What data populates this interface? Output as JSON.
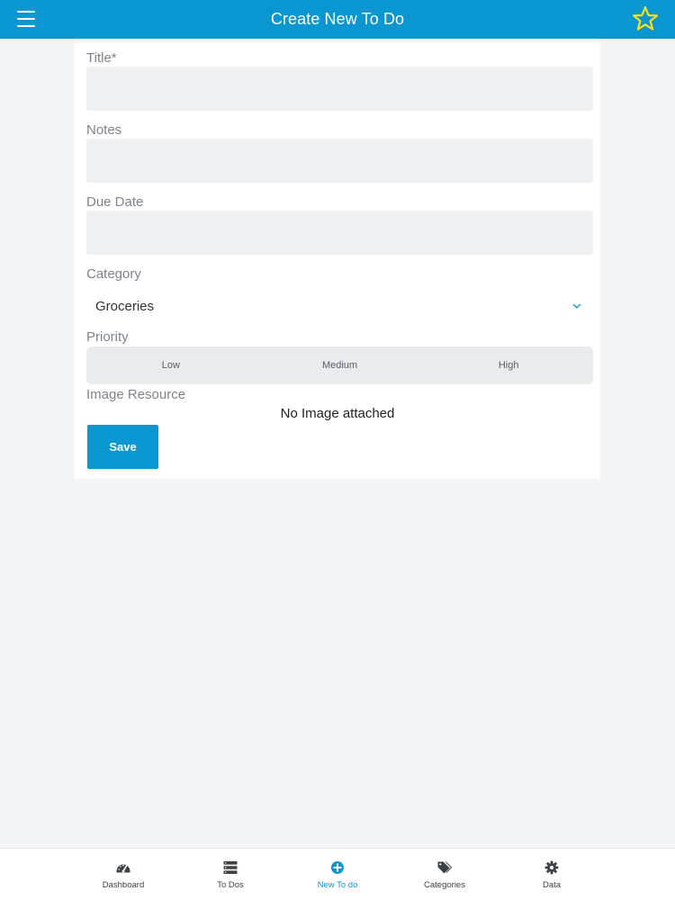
{
  "header": {
    "title": "Create New To Do",
    "menu_icon": "hamburger-menu-icon",
    "star_icon": "star-icon",
    "accent_color": "#0a96d1",
    "star_color": "#f4e21a"
  },
  "form": {
    "title_label": "Title*",
    "title_value": "",
    "notes_label": "Notes",
    "notes_value": "",
    "due_date_label": "Due Date",
    "due_date_value": "",
    "category_label": "Category",
    "category_value": "Groceries",
    "priority_label": "Priority",
    "priority_options": [
      "Low",
      "Medium",
      "High"
    ],
    "image_label": "Image Resource",
    "image_status": "No Image attached",
    "save_label": "Save"
  },
  "tabbar": {
    "items": [
      {
        "label": "Dashboard",
        "icon": "dashboard-gauge-icon",
        "active": false
      },
      {
        "label": "To Dos",
        "icon": "list-icon",
        "active": false
      },
      {
        "label": "New To do",
        "icon": "plus-circle-icon",
        "active": true
      },
      {
        "label": "Categories",
        "icon": "tags-icon",
        "active": false
      },
      {
        "label": "Data",
        "icon": "gear-icon",
        "active": false
      }
    ]
  }
}
